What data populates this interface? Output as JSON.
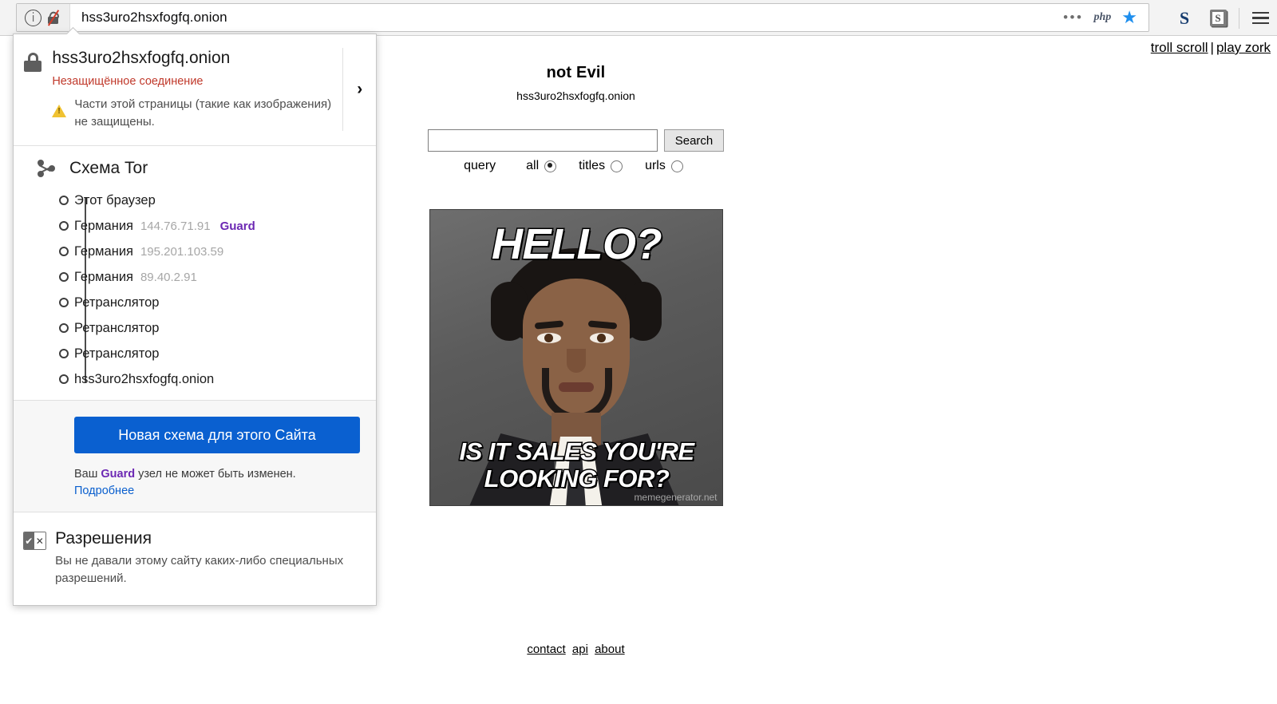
{
  "browser": {
    "url": "hss3uro2hsxfogfq.onion",
    "identity_icon": "info-icon",
    "security_icon": "broken-lock-icon",
    "overflow_icon": "three-dots-icon",
    "php_badge": "php",
    "bookmark_icon": "star-icon",
    "ext_s_icon": "S",
    "ext_note_icon": "S",
    "menu_icon": "hamburger-icon"
  },
  "identity_panel": {
    "host": "hss3uro2hsxfogfq.onion",
    "connection_status": "Незащищённое соединение",
    "mixed_content_warning": "Части этой страницы (такие как изображения) не защищены.",
    "expand_chevron": "›",
    "tor": {
      "title": "Схема Tor",
      "nodes": [
        {
          "label": "Этот браузер",
          "ip": "",
          "role": ""
        },
        {
          "label": "Германия",
          "ip": "144.76.71.91",
          "role": "Guard"
        },
        {
          "label": "Германия",
          "ip": "195.201.103.59",
          "role": ""
        },
        {
          "label": "Германия",
          "ip": "89.40.2.91",
          "role": ""
        },
        {
          "label": "Ретранслятор",
          "ip": "",
          "role": ""
        },
        {
          "label": "Ретранслятор",
          "ip": "",
          "role": ""
        },
        {
          "label": "Ретранслятор",
          "ip": "",
          "role": ""
        },
        {
          "label": "hss3uro2hsxfogfq.onion",
          "ip": "",
          "role": ""
        }
      ],
      "new_circuit_button": "Новая схема для этого Сайта",
      "guard_note_prefix": "Ваш ",
      "guard_note_bold": "Guard",
      "guard_note_suffix": " узел не может быть изменен.",
      "learn_more": "Подробнее"
    },
    "permissions": {
      "title": "Разрешения",
      "description": "Вы не давали этому сайту каких-либо специальных разрешений."
    },
    "colors": {
      "insecure_red": "#c0392b",
      "guard_purple": "#6c28b3",
      "button_blue": "#0a60d0",
      "link_blue": "#0a5fce"
    }
  },
  "page": {
    "top_links": {
      "troll_scroll": "troll scroll",
      "separator": "|",
      "play_zork": "play zork"
    },
    "site_title": "not Evil",
    "site_onion": "hss3uro2hsxfogfq.onion",
    "search": {
      "value": "",
      "placeholder": "",
      "button_label": "Search",
      "query_label": "query",
      "options": [
        {
          "label": "all",
          "selected": false
        },
        {
          "label": "titles",
          "selected": true
        },
        {
          "label": "urls",
          "selected": false
        }
      ]
    },
    "meme": {
      "top_text": "HELLO?",
      "bottom_text": "IS IT SALES YOU'RE LOOKING FOR?",
      "watermark": "memegenerator.net"
    },
    "footer": {
      "contact": "contact",
      "api": "api",
      "about": "about"
    }
  }
}
